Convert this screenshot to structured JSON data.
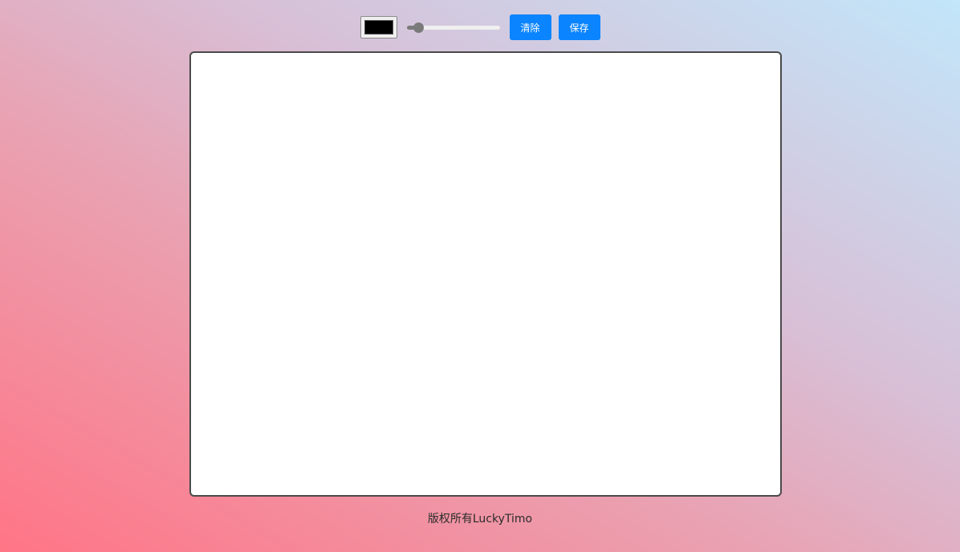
{
  "toolbar": {
    "pen_color": "#000000",
    "brush_size_fraction": 0.12,
    "clear_label": "清除",
    "save_label": "保存"
  },
  "footer": {
    "text": "版权所有LuckyTimo"
  },
  "colors": {
    "button": "#0a84ff",
    "canvas": "#ffffff"
  }
}
